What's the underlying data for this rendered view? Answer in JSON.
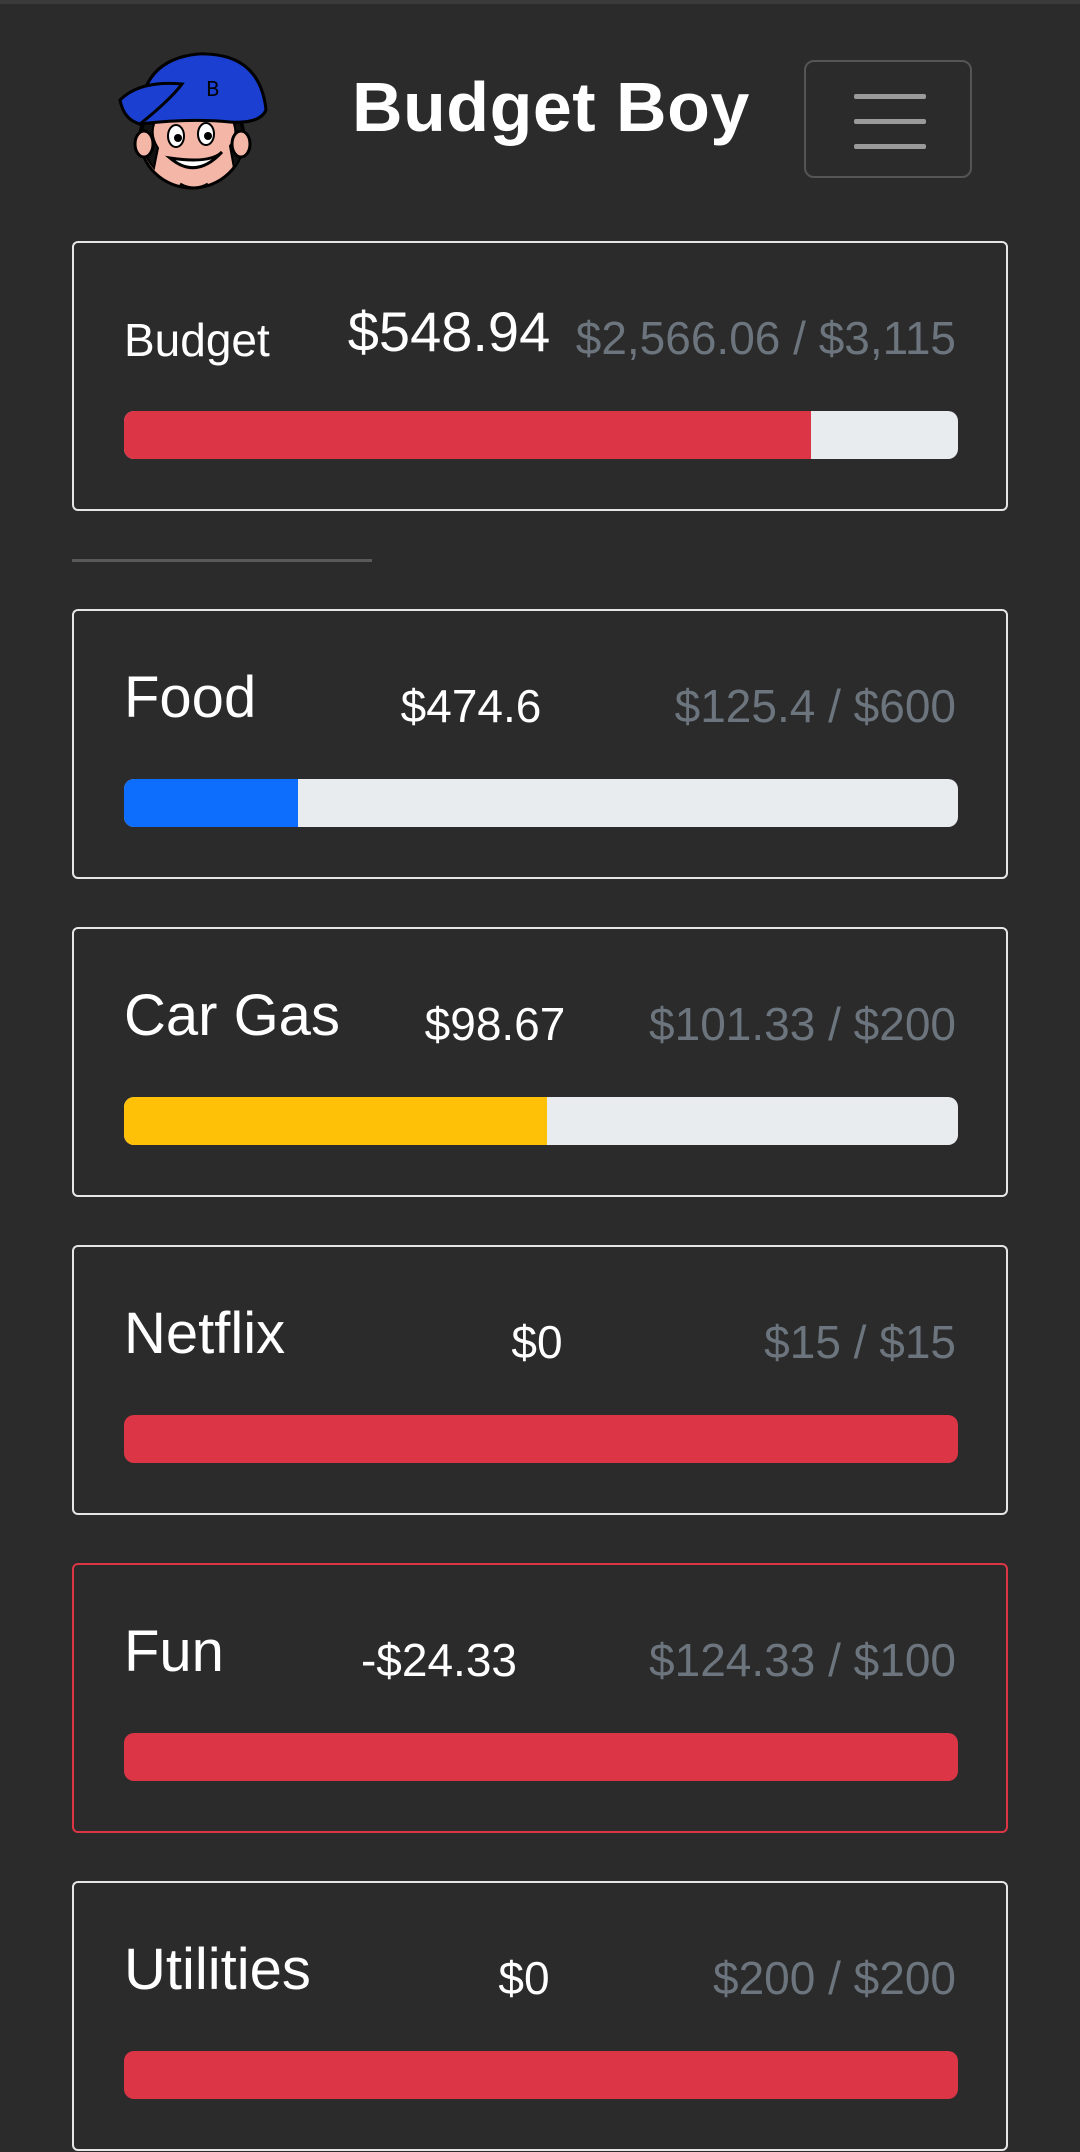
{
  "header": {
    "title": "Budget Boy",
    "menu_icon": "hamburger-icon"
  },
  "budget": {
    "label": "Budget",
    "remaining": "$548.94",
    "ratio": "$2,566.06 / $3,115",
    "progress": 0.824,
    "color": "#dc3545"
  },
  "categories": [
    {
      "name": "Food",
      "remaining": "$474.6",
      "ratio": "$125.4 / $600",
      "progress": 0.209,
      "color": "#0d6efd"
    },
    {
      "name": "Car Gas",
      "remaining": "$98.67",
      "ratio": "$101.33 / $200",
      "progress": 0.507,
      "color": "#ffc107"
    },
    {
      "name": "Netflix",
      "remaining": "$0",
      "ratio": "$15 / $15",
      "progress": 1.0,
      "color": "#dc3545"
    },
    {
      "name": "Fun",
      "remaining": "-$24.33",
      "ratio": "$124.33 / $100",
      "progress": 1.0,
      "color": "#dc3545",
      "over_budget": true
    },
    {
      "name": "Utilities",
      "remaining": "$0",
      "ratio": "$200 / $200",
      "progress": 1.0,
      "color": "#dc3545"
    }
  ]
}
